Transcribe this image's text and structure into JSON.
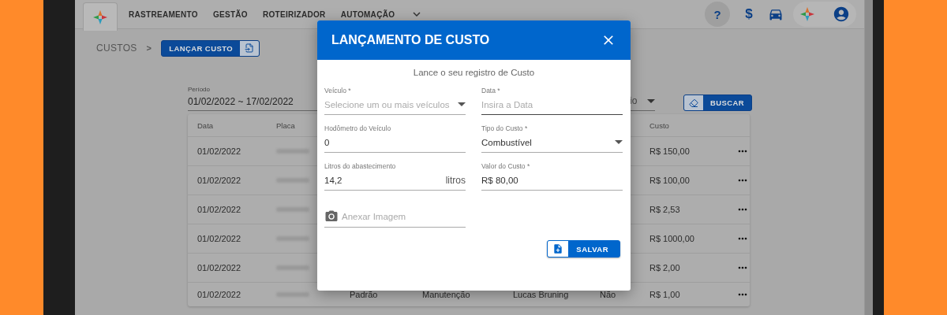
{
  "nav": {
    "home": {
      "selected": true
    },
    "items": [
      {
        "label": "RASTREAMENTO"
      },
      {
        "label": "GESTÃO"
      },
      {
        "label": "ROTEIRIZADOR"
      },
      {
        "label": "AUTOMAÇÃO"
      }
    ],
    "actions": [
      {
        "kind": "help",
        "label": "?",
        "highlighted": true
      },
      {
        "kind": "money",
        "label": "$",
        "highlighted": false
      }
    ]
  },
  "breadcrumb": {
    "label": "CUSTOS",
    "separator": ">",
    "button": "LANÇAR CUSTO"
  },
  "filters": {
    "period": {
      "label": "Período",
      "value": "01/02/2022 ~ 17/02/2022"
    },
    "select_value": "io",
    "search_button": "BUSCAR"
  },
  "table": {
    "columns": [
      {
        "label": "Data"
      },
      {
        "label": "Placa"
      },
      {
        "label": "Custo"
      }
    ],
    "rows": [
      {
        "data": "01/02/2022",
        "custo": "R$ 150,00"
      },
      {
        "data": "01/02/2022",
        "custo": "R$ 100,00"
      },
      {
        "data": "01/02/2022",
        "custo": "R$ 2,53"
      },
      {
        "data": "01/02/2022",
        "custo": "R$ 1000,00"
      },
      {
        "data": "01/02/2022",
        "custo": "R$ 2,00"
      },
      {
        "data": "01/02/2022",
        "column_3": "Padrão",
        "column_4": "Manutenção",
        "column_5": "Lucas Bruning",
        "column_6": "Não",
        "custo": "R$ 1,00"
      }
    ]
  },
  "modal": {
    "title": "LANÇAMENTO DE CUSTO",
    "subtitle": "Lance o seu registro de Custo",
    "fields": [
      {
        "kind": "select",
        "label": "Veículo *",
        "placeholder": "Selecione um ou mais veículos",
        "focused": false
      },
      {
        "kind": "text",
        "label": "Data *",
        "placeholder": "Insira a Data",
        "focused": true
      },
      {
        "kind": "text",
        "label": "Hodômetro do Veículo",
        "value": "0",
        "focused": false
      },
      {
        "kind": "select",
        "label": "Tipo do Custo *",
        "value": "Combustível",
        "focused": false
      },
      {
        "kind": "text",
        "label": "Litros do abastecimento",
        "value": "14,2",
        "suffix": "litros",
        "focused": false
      },
      {
        "kind": "text",
        "label": "Valor do Custo *",
        "value": "R$ 80,00",
        "focused": false
      }
    ],
    "attach": {
      "placeholder": "Anexar Imagem"
    },
    "save_button": "SALVAR"
  }
}
